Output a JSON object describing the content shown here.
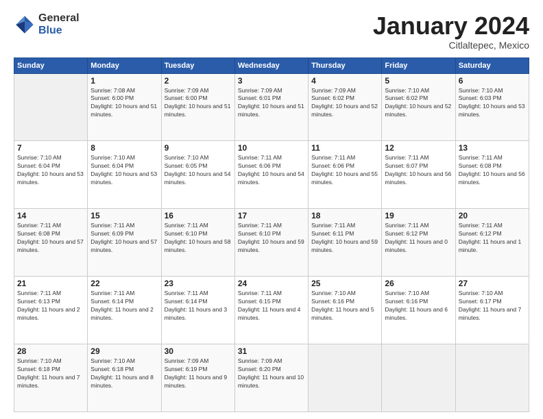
{
  "logo": {
    "general": "General",
    "blue": "Blue"
  },
  "header": {
    "month": "January 2024",
    "location": "Citlaltepec, Mexico"
  },
  "days_of_week": [
    "Sunday",
    "Monday",
    "Tuesday",
    "Wednesday",
    "Thursday",
    "Friday",
    "Saturday"
  ],
  "weeks": [
    [
      {
        "day": "",
        "empty": true
      },
      {
        "day": "1",
        "sunrise": "7:08 AM",
        "sunset": "6:00 PM",
        "daylight": "10 hours and 51 minutes."
      },
      {
        "day": "2",
        "sunrise": "7:09 AM",
        "sunset": "6:00 PM",
        "daylight": "10 hours and 51 minutes."
      },
      {
        "day": "3",
        "sunrise": "7:09 AM",
        "sunset": "6:01 PM",
        "daylight": "10 hours and 51 minutes."
      },
      {
        "day": "4",
        "sunrise": "7:09 AM",
        "sunset": "6:02 PM",
        "daylight": "10 hours and 52 minutes."
      },
      {
        "day": "5",
        "sunrise": "7:10 AM",
        "sunset": "6:02 PM",
        "daylight": "10 hours and 52 minutes."
      },
      {
        "day": "6",
        "sunrise": "7:10 AM",
        "sunset": "6:03 PM",
        "daylight": "10 hours and 53 minutes."
      }
    ],
    [
      {
        "day": "7",
        "sunrise": "7:10 AM",
        "sunset": "6:04 PM",
        "daylight": "10 hours and 53 minutes."
      },
      {
        "day": "8",
        "sunrise": "7:10 AM",
        "sunset": "6:04 PM",
        "daylight": "10 hours and 53 minutes."
      },
      {
        "day": "9",
        "sunrise": "7:10 AM",
        "sunset": "6:05 PM",
        "daylight": "10 hours and 54 minutes."
      },
      {
        "day": "10",
        "sunrise": "7:11 AM",
        "sunset": "6:06 PM",
        "daylight": "10 hours and 54 minutes."
      },
      {
        "day": "11",
        "sunrise": "7:11 AM",
        "sunset": "6:06 PM",
        "daylight": "10 hours and 55 minutes."
      },
      {
        "day": "12",
        "sunrise": "7:11 AM",
        "sunset": "6:07 PM",
        "daylight": "10 hours and 56 minutes."
      },
      {
        "day": "13",
        "sunrise": "7:11 AM",
        "sunset": "6:08 PM",
        "daylight": "10 hours and 56 minutes."
      }
    ],
    [
      {
        "day": "14",
        "sunrise": "7:11 AM",
        "sunset": "6:08 PM",
        "daylight": "10 hours and 57 minutes."
      },
      {
        "day": "15",
        "sunrise": "7:11 AM",
        "sunset": "6:09 PM",
        "daylight": "10 hours and 57 minutes."
      },
      {
        "day": "16",
        "sunrise": "7:11 AM",
        "sunset": "6:10 PM",
        "daylight": "10 hours and 58 minutes."
      },
      {
        "day": "17",
        "sunrise": "7:11 AM",
        "sunset": "6:10 PM",
        "daylight": "10 hours and 59 minutes."
      },
      {
        "day": "18",
        "sunrise": "7:11 AM",
        "sunset": "6:11 PM",
        "daylight": "10 hours and 59 minutes."
      },
      {
        "day": "19",
        "sunrise": "7:11 AM",
        "sunset": "6:12 PM",
        "daylight": "11 hours and 0 minutes."
      },
      {
        "day": "20",
        "sunrise": "7:11 AM",
        "sunset": "6:12 PM",
        "daylight": "11 hours and 1 minute."
      }
    ],
    [
      {
        "day": "21",
        "sunrise": "7:11 AM",
        "sunset": "6:13 PM",
        "daylight": "11 hours and 2 minutes."
      },
      {
        "day": "22",
        "sunrise": "7:11 AM",
        "sunset": "6:14 PM",
        "daylight": "11 hours and 2 minutes."
      },
      {
        "day": "23",
        "sunrise": "7:11 AM",
        "sunset": "6:14 PM",
        "daylight": "11 hours and 3 minutes."
      },
      {
        "day": "24",
        "sunrise": "7:11 AM",
        "sunset": "6:15 PM",
        "daylight": "11 hours and 4 minutes."
      },
      {
        "day": "25",
        "sunrise": "7:10 AM",
        "sunset": "6:16 PM",
        "daylight": "11 hours and 5 minutes."
      },
      {
        "day": "26",
        "sunrise": "7:10 AM",
        "sunset": "6:16 PM",
        "daylight": "11 hours and 6 minutes."
      },
      {
        "day": "27",
        "sunrise": "7:10 AM",
        "sunset": "6:17 PM",
        "daylight": "11 hours and 7 minutes."
      }
    ],
    [
      {
        "day": "28",
        "sunrise": "7:10 AM",
        "sunset": "6:18 PM",
        "daylight": "11 hours and 7 minutes."
      },
      {
        "day": "29",
        "sunrise": "7:10 AM",
        "sunset": "6:18 PM",
        "daylight": "11 hours and 8 minutes."
      },
      {
        "day": "30",
        "sunrise": "7:09 AM",
        "sunset": "6:19 PM",
        "daylight": "11 hours and 9 minutes."
      },
      {
        "day": "31",
        "sunrise": "7:09 AM",
        "sunset": "6:20 PM",
        "daylight": "11 hours and 10 minutes."
      },
      {
        "day": "",
        "empty": true
      },
      {
        "day": "",
        "empty": true
      },
      {
        "day": "",
        "empty": true
      }
    ]
  ]
}
